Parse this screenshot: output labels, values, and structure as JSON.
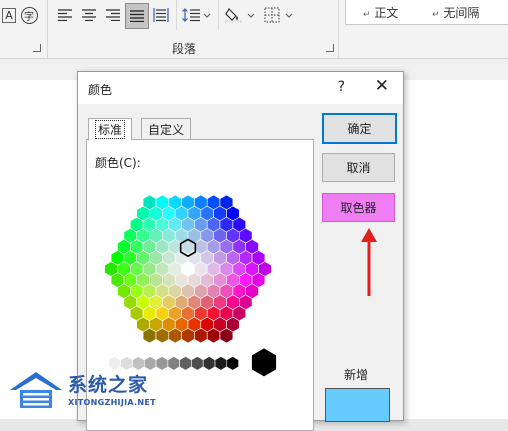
{
  "ribbon": {
    "char_border_glyph": "A",
    "char_enclose_glyph": "字",
    "paragraph_group_label": "段落",
    "styles": [
      "正文",
      "无间隔"
    ],
    "style_marker": "↵"
  },
  "dialog": {
    "title": "颜色",
    "help": "?",
    "close": "✕",
    "tabs": [
      "标准",
      "自定义"
    ],
    "colors_label": "颜色(C):",
    "buttons": {
      "ok": "确定",
      "cancel": "取消",
      "picker": "取色器"
    },
    "new_label": "新增",
    "new_color": "#66ccff"
  },
  "annotation": {
    "arrow_color": "#e0201f"
  },
  "watermark": {
    "name": "系统之家",
    "url": "XITONGZHIJIA.NET"
  }
}
